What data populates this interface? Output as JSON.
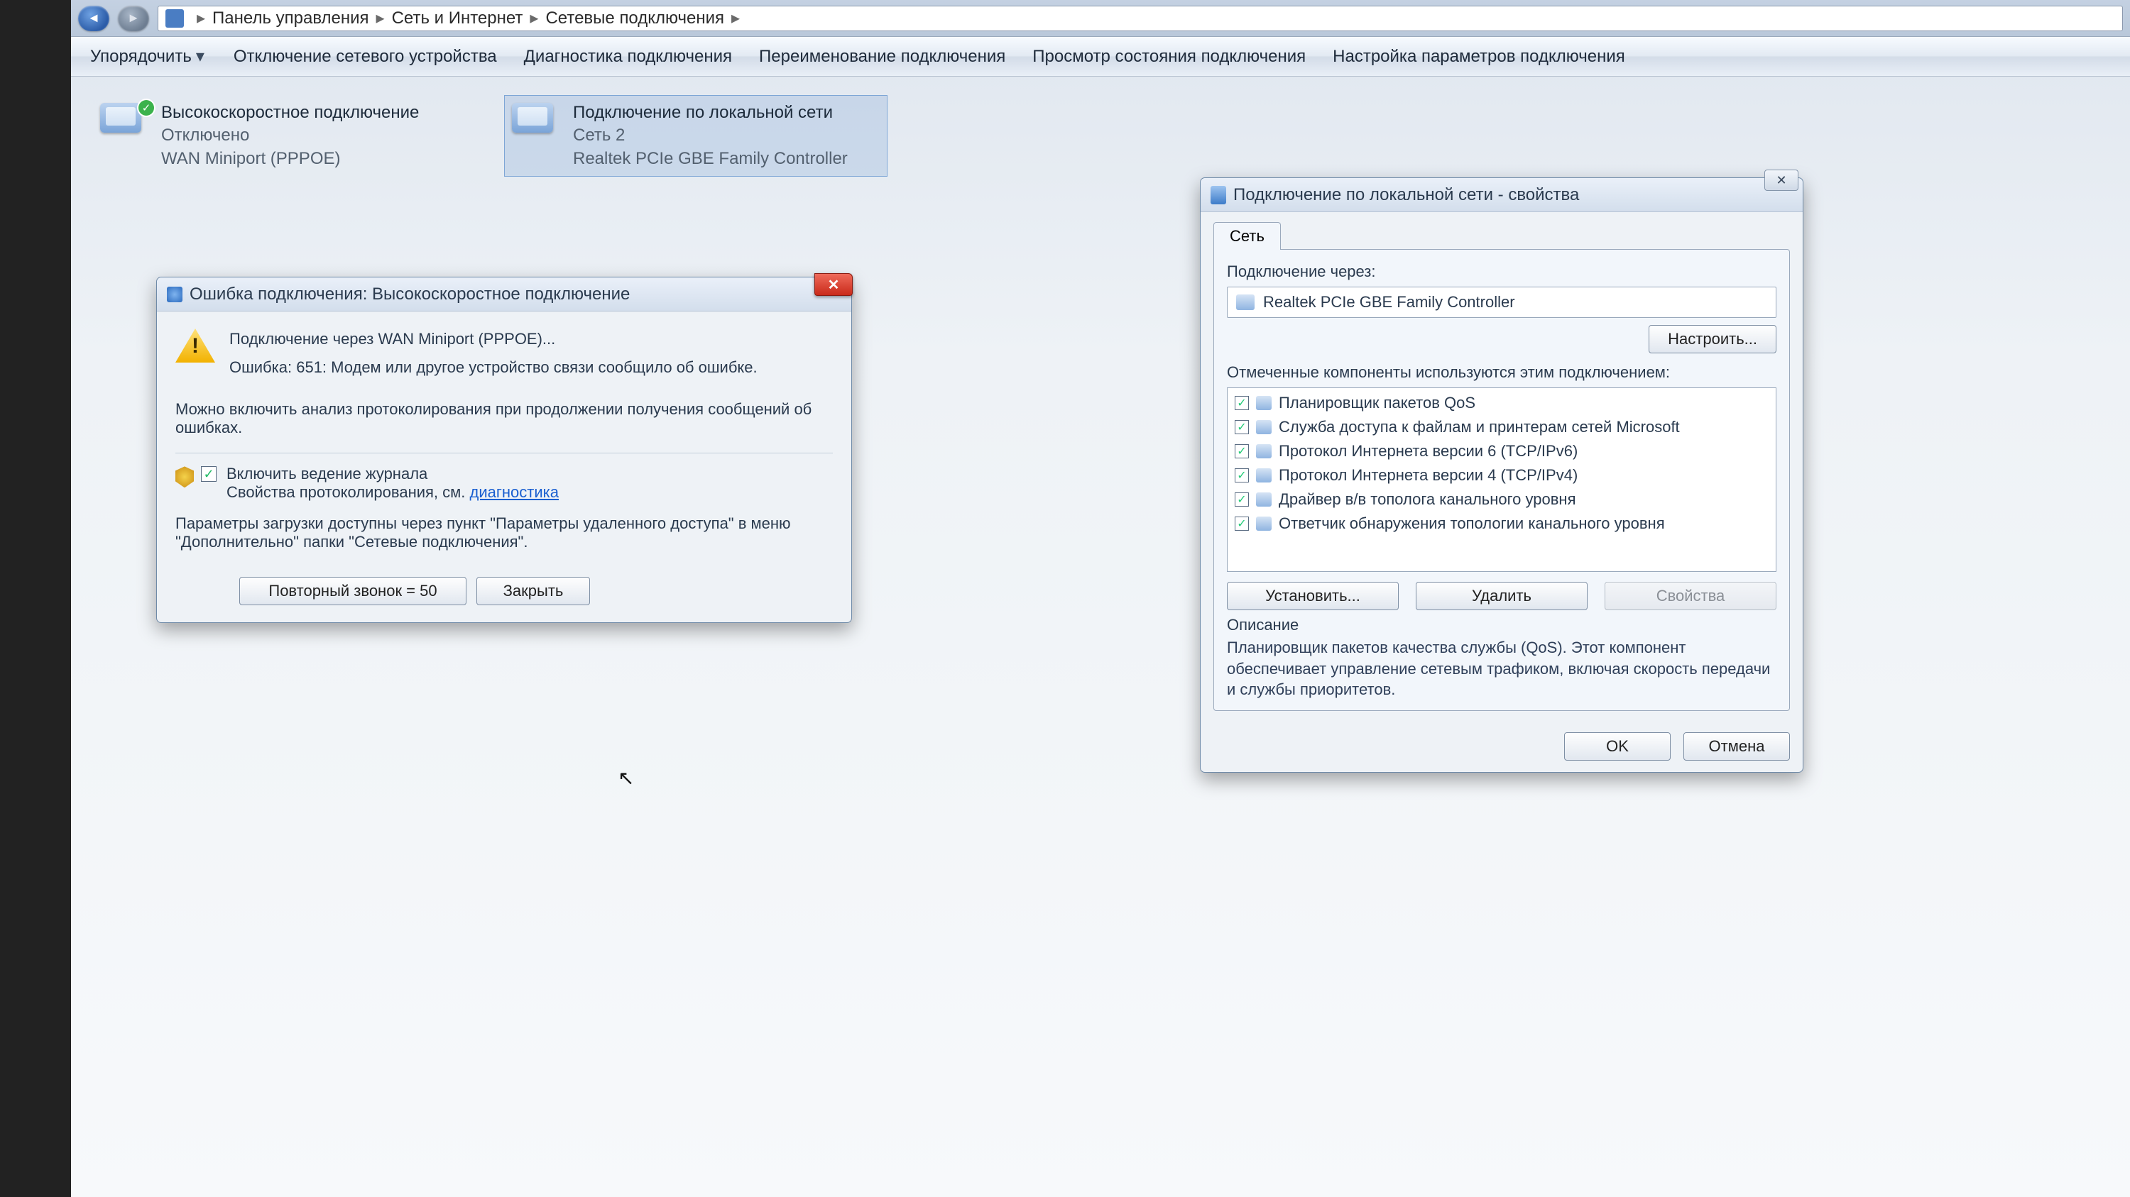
{
  "breadcrumb": {
    "items": [
      "Панель управления",
      "Сеть и Интернет",
      "Сетевые подключения"
    ]
  },
  "toolbar": {
    "organize": "Упорядочить",
    "items": [
      "Отключение сетевого устройства",
      "Диагностика подключения",
      "Переименование подключения",
      "Просмотр состояния подключения",
      "Настройка параметров подключения"
    ]
  },
  "tiles": [
    {
      "name": "Высокоскоростное подключение",
      "status": "Отключено",
      "device": "WAN Miniport (PPPOE)",
      "overlay": "✓"
    },
    {
      "name": "Подключение по локальной сети",
      "status": "Сеть  2",
      "device": "Realtek PCIe GBE Family Controller",
      "overlay": ""
    }
  ],
  "error_dialog": {
    "title": "Ошибка подключения: Высокоскоростное подключение",
    "via": "Подключение через WAN Miniport (PPPOE)...",
    "code": "Ошибка: 651: Модем или другое устройство связи сообщило об ошибке.",
    "analysis": "Можно включить анализ протоколирования при продолжении получения сообщений об ошибках.",
    "enable_log": "Включить ведение журнала",
    "log_props_prefix": "Свойства протоколирования, см. ",
    "log_props_link": "диагностика",
    "params_note": "Параметры загрузки доступны через пункт \"Параметры удаленного доступа\" в меню \"Дополнительно\" папки \"Сетевые подключения\".",
    "redial": "Повторный звонок = 50",
    "close": "Закрыть"
  },
  "props_dialog": {
    "title": "Подключение по локальной сети - свойства",
    "tab": "Сеть",
    "connect_via": "Подключение через:",
    "adapter": "Realtek PCIe GBE Family Controller",
    "configure": "Настроить...",
    "components_label": "Отмеченные компоненты используются этим подключением:",
    "components": [
      "Планировщик пакетов QoS",
      "Служба доступа к файлам и принтерам сетей Microsoft",
      "Протокол Интернета версии 6 (TCP/IPv6)",
      "Протокол Интернета версии 4 (TCP/IPv4)",
      "Драйвер в/в тополога канального уровня",
      "Ответчик обнаружения топологии канального уровня"
    ],
    "install": "Установить...",
    "uninstall": "Удалить",
    "properties": "Свойства",
    "desc_title": "Описание",
    "desc_text": "Планировщик пакетов качества службы (QoS). Этот компонент обеспечивает управление сетевым трафиком, включая скорость передачи и службы приоритетов.",
    "ok": "OK",
    "cancel": "Отмена"
  }
}
